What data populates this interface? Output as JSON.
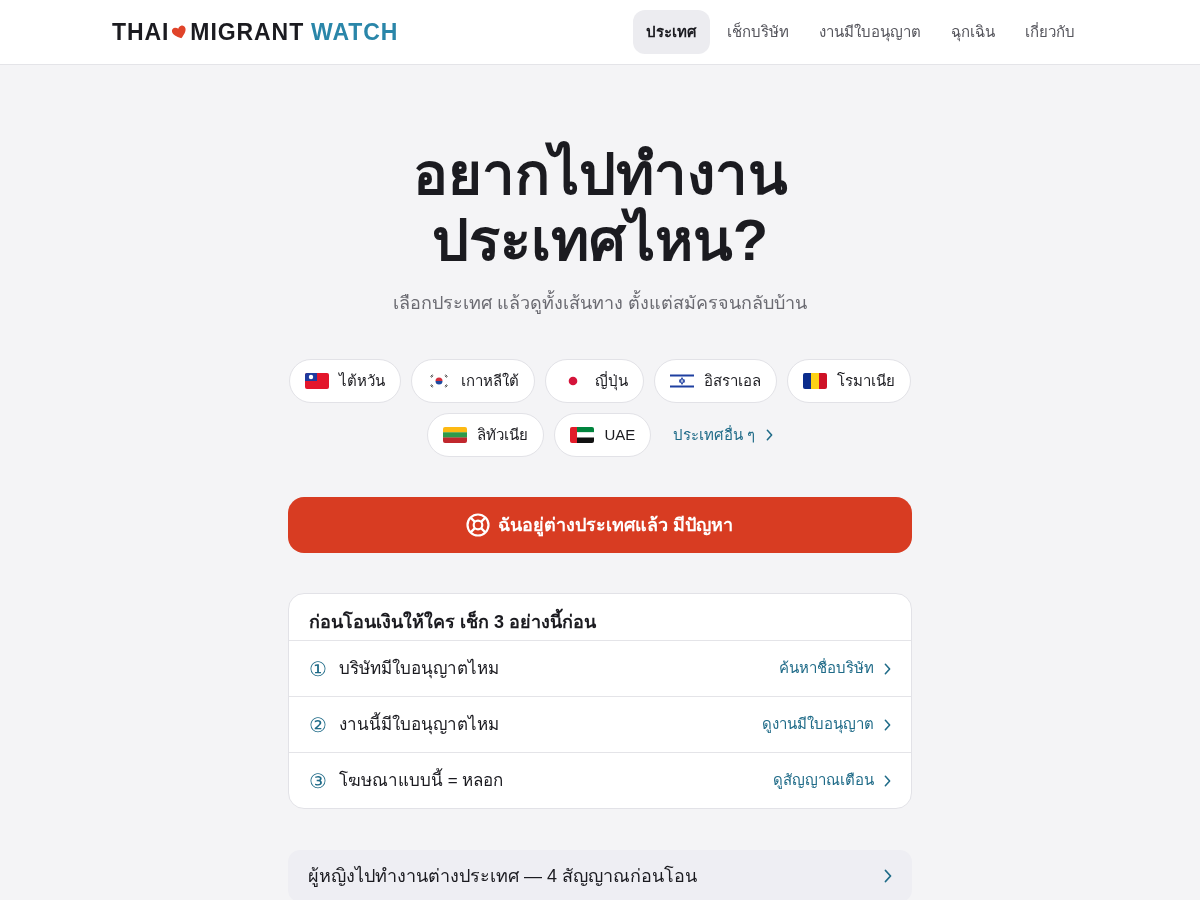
{
  "header": {
    "logo": {
      "first": "THAI",
      "second": "MIGRANT",
      "accent": "WATCH"
    },
    "nav": [
      {
        "label": "ประเทศ",
        "selected": true
      },
      {
        "label": "เช็กบริษัท",
        "selected": false
      },
      {
        "label": "งานมีใบอนุญาต",
        "selected": false
      },
      {
        "label": "ฉุกเฉิน",
        "selected": false
      },
      {
        "label": "เกี่ยวกับ",
        "selected": false
      }
    ]
  },
  "hero": {
    "title_lines": [
      "อยากไปทำงาน",
      "ประเทศไหน?"
    ],
    "subtitle": "เลือกประเทศ แล้วดูทั้งเส้นทาง ตั้งแต่สมัครจนกลับบ้าน"
  },
  "countries": [
    {
      "name": "ไต้หวัน",
      "kind": "taiwan"
    },
    {
      "name": "เกาหลีใต้",
      "kind": "korea"
    },
    {
      "name": "ญี่ปุ่น",
      "kind": "japan"
    },
    {
      "name": "อิสราเอล",
      "kind": "israel"
    },
    {
      "name": "โรมาเนีย",
      "kind": "romania"
    },
    {
      "name": "ลิทัวเนีย",
      "kind": "lithuania"
    },
    {
      "name": "UAE",
      "kind": "uae"
    }
  ],
  "more_countries": "ประเทศอื่น ๆ",
  "emergency_button": "ฉันอยู่ต่างประเทศแล้ว มีปัญหา",
  "checklist": {
    "title": "ก่อนโอนเงินให้ใคร เช็ก 3 อย่างนี้ก่อน",
    "items": [
      {
        "number": "①",
        "text": "บริษัทมีใบอนุญาตไหม",
        "link": "ค้นหาชื่อบริษัท"
      },
      {
        "number": "②",
        "text": "งานนี้มีใบอนุญาตไหม",
        "link": "ดูงานมีใบอนุญาต"
      },
      {
        "number": "③",
        "text": "โฆษณาแบบนี้ = หลอก",
        "link": "ดูสัญญาณเตือน"
      }
    ]
  },
  "guide_link": "ผู้หญิงไปทำงานต่างประเทศ — 4 สัญญาณก่อนโอน"
}
